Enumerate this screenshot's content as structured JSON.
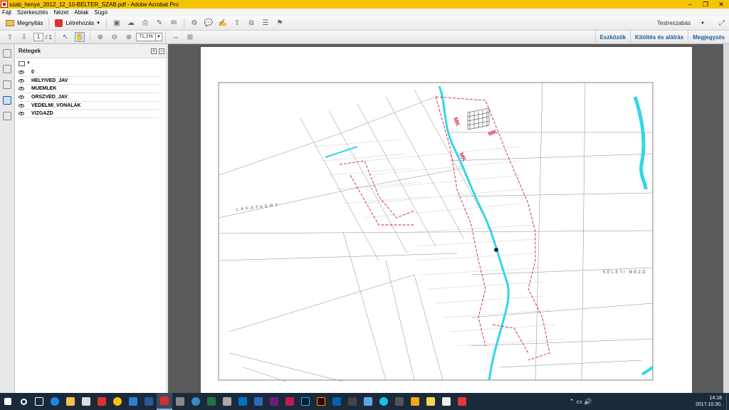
{
  "window": {
    "title": "szab_henye_2012_12_10-BELTER_SZAB.pdf - Adobe Acrobat Pro",
    "minimize": "–",
    "maximize": "❐",
    "close": "✕"
  },
  "menu": [
    "Fájl",
    "Szerkesztés",
    "Nézet",
    "Ablak",
    "Súgó"
  ],
  "toolbar": {
    "open_label": "Megnyitás",
    "create_label": "Létrehozás",
    "customize_label": "Testreszabás"
  },
  "nav": {
    "page_current": "1",
    "page_total": "/ 1",
    "zoom": "71,1%"
  },
  "panel_links": [
    "Eszközök",
    "Kitöltés és aláírás",
    "Megjegyzés"
  ],
  "layers_panel": {
    "title": "Rétegek",
    "items": [
      {
        "label": "0"
      },
      {
        "label": "HELYIVED_JAV"
      },
      {
        "label": "MUEMLEK"
      },
      {
        "label": "ORSZVED_JAV_"
      },
      {
        "label": "VEDELMI_VONALAK"
      },
      {
        "label": "VIZGAZD"
      }
    ]
  },
  "map": {
    "place_labels": [
      "LAKATKERT",
      "KELETI MEZŐ",
      "MK",
      "MK",
      "MK"
    ]
  },
  "taskbar": {
    "time": "14:18",
    "date": "2017.10.30."
  },
  "colors": {
    "titlebar": "#f5c400",
    "link": "#1d5b9b",
    "map_red": "#d0213b",
    "map_cyan": "#33d6e6"
  }
}
